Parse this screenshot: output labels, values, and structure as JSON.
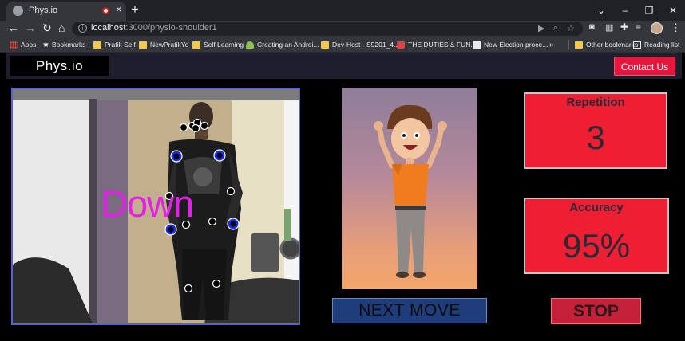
{
  "browser": {
    "tab_title": "Phys.io",
    "url_host": "localhost",
    "url_path": ":3000/physio-shoulder1",
    "bookmarks": [
      {
        "label": "Apps",
        "icon": "apps-grid-icon"
      },
      {
        "label": "Bookmarks",
        "icon": "star-icon"
      },
      {
        "label": "Pratik Self",
        "icon": "folder-icon"
      },
      {
        "label": "NewPratikYo",
        "icon": "folder-icon"
      },
      {
        "label": "Self Learning",
        "icon": "folder-icon"
      },
      {
        "label": "Creating an Androi...",
        "icon": "android-icon"
      },
      {
        "label": "Dev-Host - S9201_4...",
        "icon": "folder-icon"
      },
      {
        "label": "THE DUTIES & FUN...",
        "icon": "hat-icon"
      },
      {
        "label": "New Election proce...",
        "icon": "page-icon"
      }
    ],
    "more_bookmarks": "»",
    "other_bookmarks": "Other bookmarks",
    "reading_list": "Reading list"
  },
  "navbar": {
    "brand": "Phys.io",
    "contact": "Contact Us"
  },
  "camera": {
    "pose_label": "Down"
  },
  "controls": {
    "next_move": "NEXT MOVE",
    "stop": "STOP"
  },
  "stats": {
    "repetition_label": "Repetition",
    "repetition_value": "3",
    "accuracy_label": "Accuracy",
    "accuracy_value": "95%"
  },
  "colors": {
    "accent_red": "#ee1e33",
    "navbar_bg": "#1e1e2c",
    "next_move_bg": "#1f3d7a",
    "pose_label": "#e022e5",
    "keypoint_highlight": "#1a2ee0"
  }
}
